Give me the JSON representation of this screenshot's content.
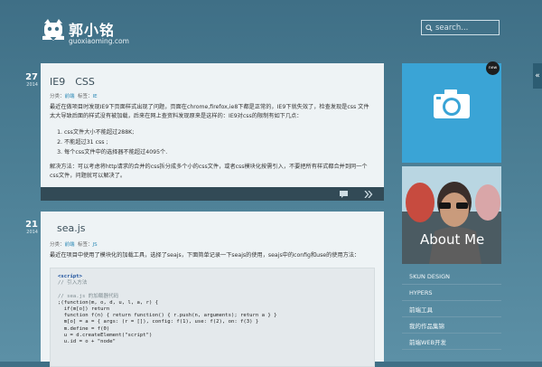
{
  "site": {
    "title": "郭小铭",
    "subtitle": "guoxiaoming.com"
  },
  "search": {
    "placeholder": "search..."
  },
  "posts": [
    {
      "day": "27",
      "year": "2014",
      "title": "IE9　CSS",
      "meta_category_label": "分类：",
      "meta_category": "前端",
      "meta_tag_label": "标签：",
      "meta_tag": "IE",
      "paragraph1": "最近在做项目时发现IE9下页面样式出现了问题，页面在chrome,firefox,ie8下都是正常的，IE9下就失效了，检查发现是css 文件太大导致后面的样式没有被加载，后来在网上查资料发现原来是这样的：IE9对css的限制有如下几点：",
      "list": [
        "css文件大小不能超过288K;",
        "不能超过31 css ;",
        "每个css文件中的选择器不能超过4095个."
      ],
      "paragraph2": "解决方法：可以考虑将http请求的合并的css拆分成多个小的css文件，或者css模块化按需引入，不要把所有样式都合并到同一个css文件，问题就可以解决了。"
    },
    {
      "day": "21",
      "year": "2014",
      "title": "sea.js",
      "meta_category_label": "分类：",
      "meta_category": "前端",
      "meta_tag_label": "标签：",
      "meta_tag": "JS",
      "paragraph1": "最近在项目中使用了模块化的加载工具，选择了seajs，下面简单记录一下seajs的使用，seajs中的config和use的使用方法：",
      "code_lines": [
        {
          "t": "tag",
          "text": "<script>"
        },
        {
          "t": "c",
          "text": "// 引入方法"
        },
        {
          "t": "plain",
          "text": ""
        },
        {
          "t": "c",
          "text": "// sea.js 的加载器代码"
        },
        {
          "t": "plain",
          "text": ";(function(m, o, d, u, l, a, r) {"
        },
        {
          "t": "plain",
          "text": "  if(m[o]) return"
        },
        {
          "t": "plain",
          "text": "  function f(n) { return function() { r.push(n, arguments); return a } }"
        },
        {
          "t": "plain",
          "text": "  m[o] = a = { args: (r = []), config: f(1), use: f(2), on: f(3) }"
        },
        {
          "t": "plain",
          "text": "  m.define = f(0)"
        },
        {
          "t": "plain",
          "text": "  u = d.createElement(\"script\")"
        },
        {
          "t": "plain",
          "text": "  u.id = o + \"node\""
        }
      ]
    }
  ],
  "sidebar": {
    "new_badge": "new",
    "about_label": "About Me",
    "nav_items": [
      "5KUN DESIGN",
      "HYPERS",
      "前端工具",
      "我的作品集锦",
      "前端WEB开发"
    ]
  },
  "side_tab_label": "«"
}
